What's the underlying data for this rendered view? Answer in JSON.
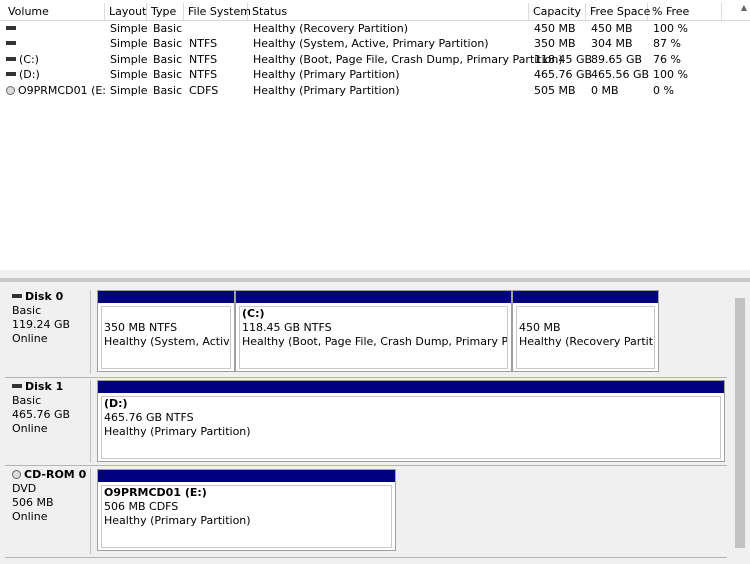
{
  "columns": [
    "Volume",
    "Layout",
    "Type",
    "File System",
    "Status",
    "Capacity",
    "Free Space",
    "% Free"
  ],
  "volumes": [
    {
      "icon": "drive-icon",
      "name": "",
      "layout": "Simple",
      "type": "Basic",
      "fs": "",
      "status": "Healthy (Recovery Partition)",
      "capacity": "450 MB",
      "free": "450 MB",
      "pct": "100 %"
    },
    {
      "icon": "drive-icon",
      "name": "",
      "layout": "Simple",
      "type": "Basic",
      "fs": "NTFS",
      "status": "Healthy (System, Active, Primary Partition)",
      "capacity": "350 MB",
      "free": "304 MB",
      "pct": "87 %"
    },
    {
      "icon": "drive-icon",
      "name": "(C:)",
      "layout": "Simple",
      "type": "Basic",
      "fs": "NTFS",
      "status": "Healthy (Boot, Page File, Crash Dump, Primary Partition)",
      "capacity": "118.45 GB",
      "free": "89.65 GB",
      "pct": "76 %"
    },
    {
      "icon": "drive-icon",
      "name": "(D:)",
      "layout": "Simple",
      "type": "Basic",
      "fs": "NTFS",
      "status": "Healthy (Primary Partition)",
      "capacity": "465.76 GB",
      "free": "465.56 GB",
      "pct": "100 %"
    },
    {
      "icon": "cd-icon",
      "name": "O9PRMCD01 (E:)",
      "layout": "Simple",
      "type": "Basic",
      "fs": "CDFS",
      "status": "Healthy (Primary Partition)",
      "capacity": "505 MB",
      "free": "0 MB",
      "pct": "0 %"
    }
  ],
  "disks": [
    {
      "name": "Disk 0",
      "type": "Basic",
      "size": "119.24 GB",
      "state": "Online",
      "partitions": [
        {
          "title": "",
          "size": "350 MB NTFS",
          "status": "Healthy (System, Active, P"
        },
        {
          "title": "(C:)",
          "size": "118.45 GB NTFS",
          "status": "Healthy (Boot, Page File, Crash Dump, Primary Partitior"
        },
        {
          "title": "",
          "size": "450 MB",
          "status": "Healthy (Recovery Partition)"
        }
      ]
    },
    {
      "name": "Disk 1",
      "type": "Basic",
      "size": "465.76 GB",
      "state": "Online",
      "partitions": [
        {
          "title": "(D:)",
          "size": "465.76 GB NTFS",
          "status": "Healthy (Primary Partition)"
        }
      ]
    },
    {
      "name": "CD-ROM 0",
      "type": "DVD",
      "size": "506 MB",
      "state": "Online",
      "partitions": [
        {
          "title": "O9PRMCD01  (E:)",
          "size": "506 MB CDFS",
          "status": "Healthy (Primary Partition)"
        }
      ]
    }
  ],
  "scroll_up_glyph": "▲"
}
